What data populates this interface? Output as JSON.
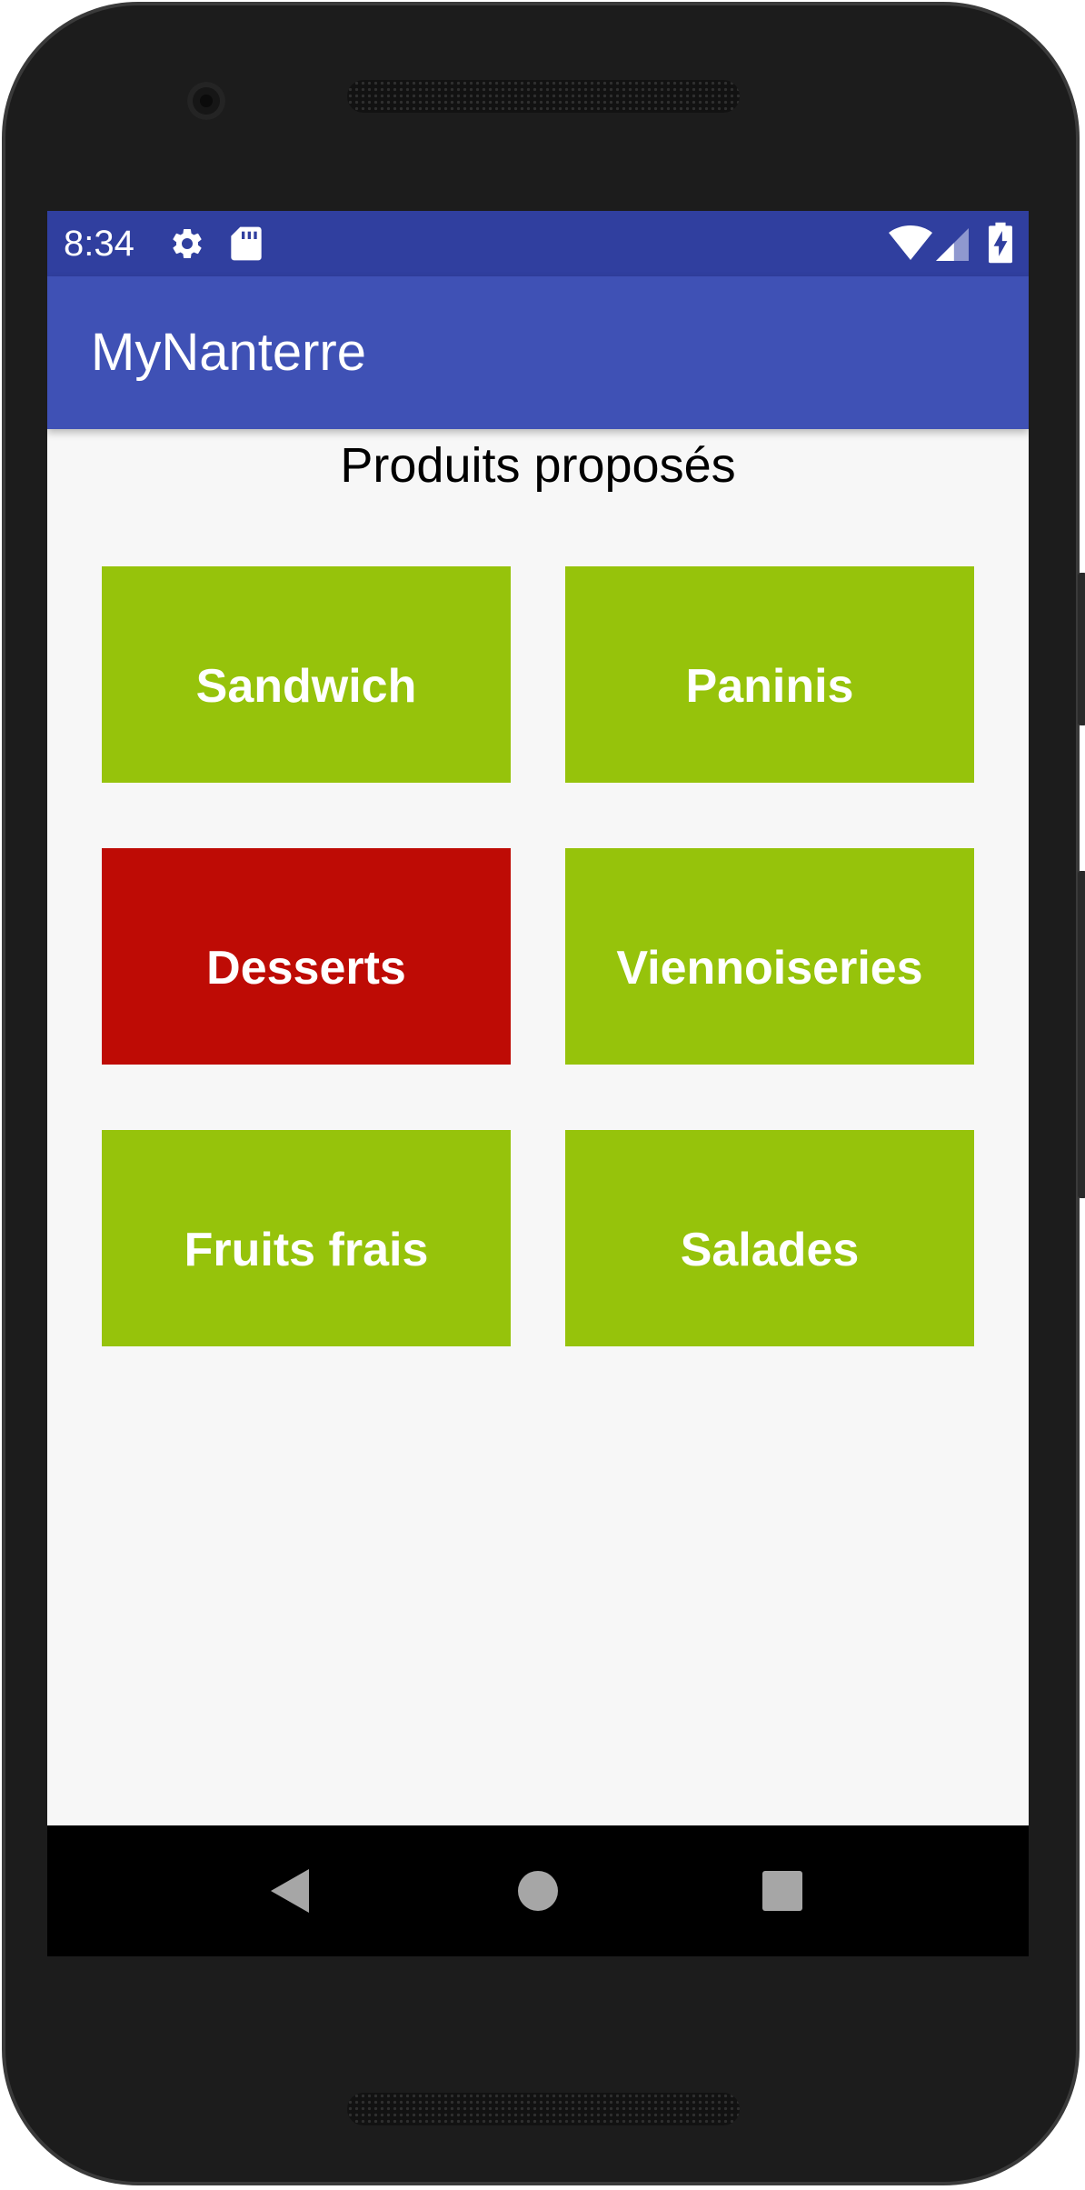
{
  "status_bar": {
    "time": "8:34",
    "icons": [
      "gear-icon",
      "sd-card-icon",
      "wifi-icon",
      "signal-icon",
      "battery-charging-icon"
    ]
  },
  "app_bar": {
    "title": "MyNanterre"
  },
  "content": {
    "title": "Produits proposés",
    "tiles": [
      {
        "label": "Sandwich",
        "color": "#96c30b"
      },
      {
        "label": "Paninis",
        "color": "#96c30b"
      },
      {
        "label": "Desserts",
        "color": "#be0b05"
      },
      {
        "label": "Viennoiseries",
        "color": "#96c30b"
      },
      {
        "label": "Fruits frais",
        "color": "#96c30b"
      },
      {
        "label": "Salades",
        "color": "#96c30b"
      }
    ]
  },
  "nav_bar": {
    "buttons": [
      "back-icon",
      "home-icon",
      "recents-icon"
    ]
  },
  "colors": {
    "status_bar": "#303f9f",
    "app_bar": "#3f51b5",
    "background": "#f7f7f7",
    "tile_default": "#96c30b",
    "tile_selected": "#be0b05"
  }
}
